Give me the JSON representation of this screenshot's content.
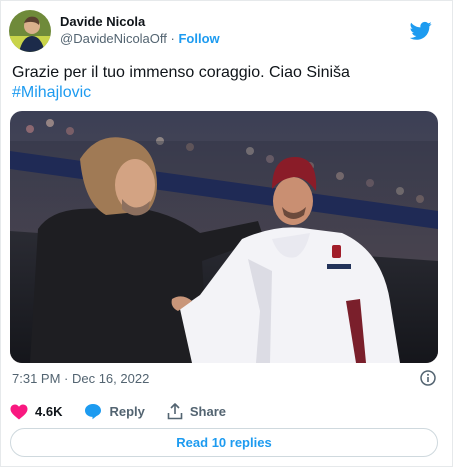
{
  "author": {
    "name": "Davide Nicola",
    "handle": "@DavideNicolaOff",
    "separator": "·",
    "follow_label": "Follow"
  },
  "tweet": {
    "text": "Grazie per il tuo immenso coraggio. Ciao Siniša",
    "hashtag": "#Mihajlovic",
    "timestamp": "7:31 PM · Dec 16, 2022"
  },
  "actions": {
    "likes": "4.6K",
    "reply_label": "Reply",
    "share_label": "Share"
  },
  "replies_button": "Read 10 replies",
  "colors": {
    "accent": "#1d9bf0",
    "like": "#f91880",
    "text": "#0f1419",
    "muted": "#536471"
  },
  "icons": {
    "brand": "twitter-bird-icon",
    "info": "info-icon",
    "like": "heart-icon",
    "reply": "speech-bubble-icon",
    "share": "share-upload-icon"
  }
}
